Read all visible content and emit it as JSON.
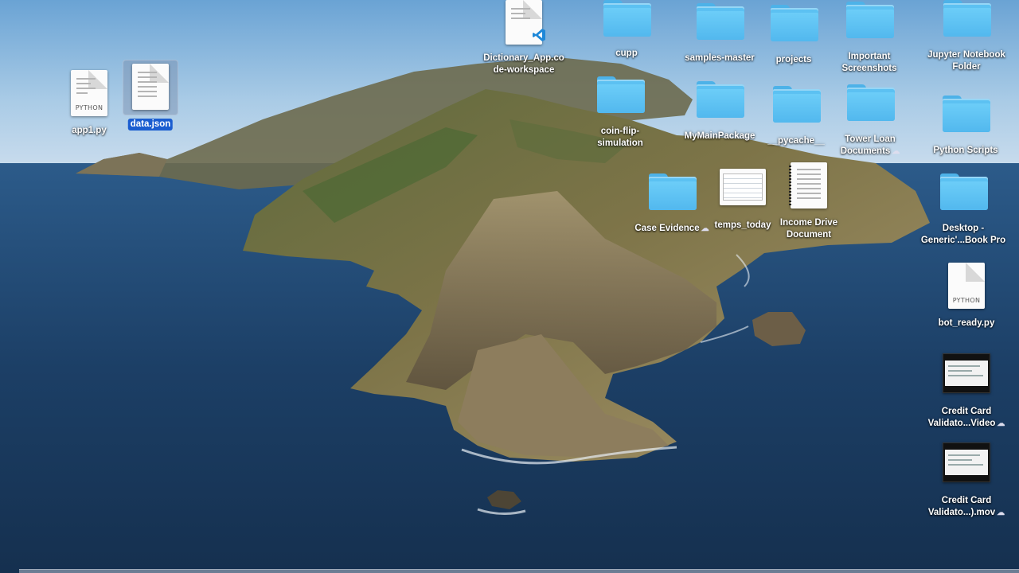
{
  "desktop": {
    "icons": [
      {
        "label": "app1.py",
        "kind": "python-file",
        "tag": "PYTHON"
      },
      {
        "label": "data.json",
        "kind": "text-file",
        "selected": true
      },
      {
        "label": "Dictionary_App.co de-workspace",
        "lines": [
          "Dictionary_App.co",
          "de-workspace"
        ],
        "kind": "vscode-workspace"
      },
      {
        "label": "cupp",
        "kind": "folder"
      },
      {
        "label": "samples-master",
        "kind": "folder"
      },
      {
        "label": "projects",
        "kind": "folder"
      },
      {
        "label": "Important Screenshots",
        "lines": [
          "Important",
          "Screenshots"
        ],
        "kind": "folder"
      },
      {
        "label": "Jupyter Notebook Folder",
        "lines": [
          "Jupyter Notebook",
          "Folder"
        ],
        "kind": "folder"
      },
      {
        "label": "coin-flip-simulation",
        "lines": [
          "coin-flip-",
          "simulation"
        ],
        "kind": "folder"
      },
      {
        "label": "MyMainPackage",
        "kind": "folder"
      },
      {
        "label": "__pycache__",
        "kind": "folder"
      },
      {
        "label": "Tower Loan Documents",
        "lines": [
          "Tower Loan",
          "Documents"
        ],
        "kind": "folder",
        "cloud": true
      },
      {
        "label": "Python Scripts",
        "kind": "folder"
      },
      {
        "label": "Case Evidence",
        "kind": "folder",
        "cloud": true
      },
      {
        "label": "temps_today",
        "kind": "spreadsheet"
      },
      {
        "label": "Income Drive Document",
        "lines": [
          "Income Drive",
          "Document"
        ],
        "kind": "scanned-document"
      },
      {
        "label": "Desktop - Generic'...Book Pro",
        "lines": [
          "Desktop -",
          "Generic'...Book Pro"
        ],
        "kind": "folder"
      },
      {
        "label": "bot_ready.py",
        "kind": "python-file",
        "tag": "PYTHON"
      },
      {
        "label": "Credit Card Validato...Video",
        "lines": [
          "Credit Card",
          "Validato...Video"
        ],
        "kind": "video",
        "cloud": true
      },
      {
        "label": "Credit Card Validato...).mov",
        "lines": [
          "Credit Card",
          "Validato...).mov"
        ],
        "kind": "video",
        "cloud": true
      }
    ]
  },
  "colors": {
    "folder": "#5cc1f2",
    "selection": "#1b5dd0",
    "sky": "#9ec6e4",
    "sea": "#1d3f66"
  },
  "icons": {
    "cloud": "cloud-icon",
    "vscode": "vscode-icon"
  }
}
